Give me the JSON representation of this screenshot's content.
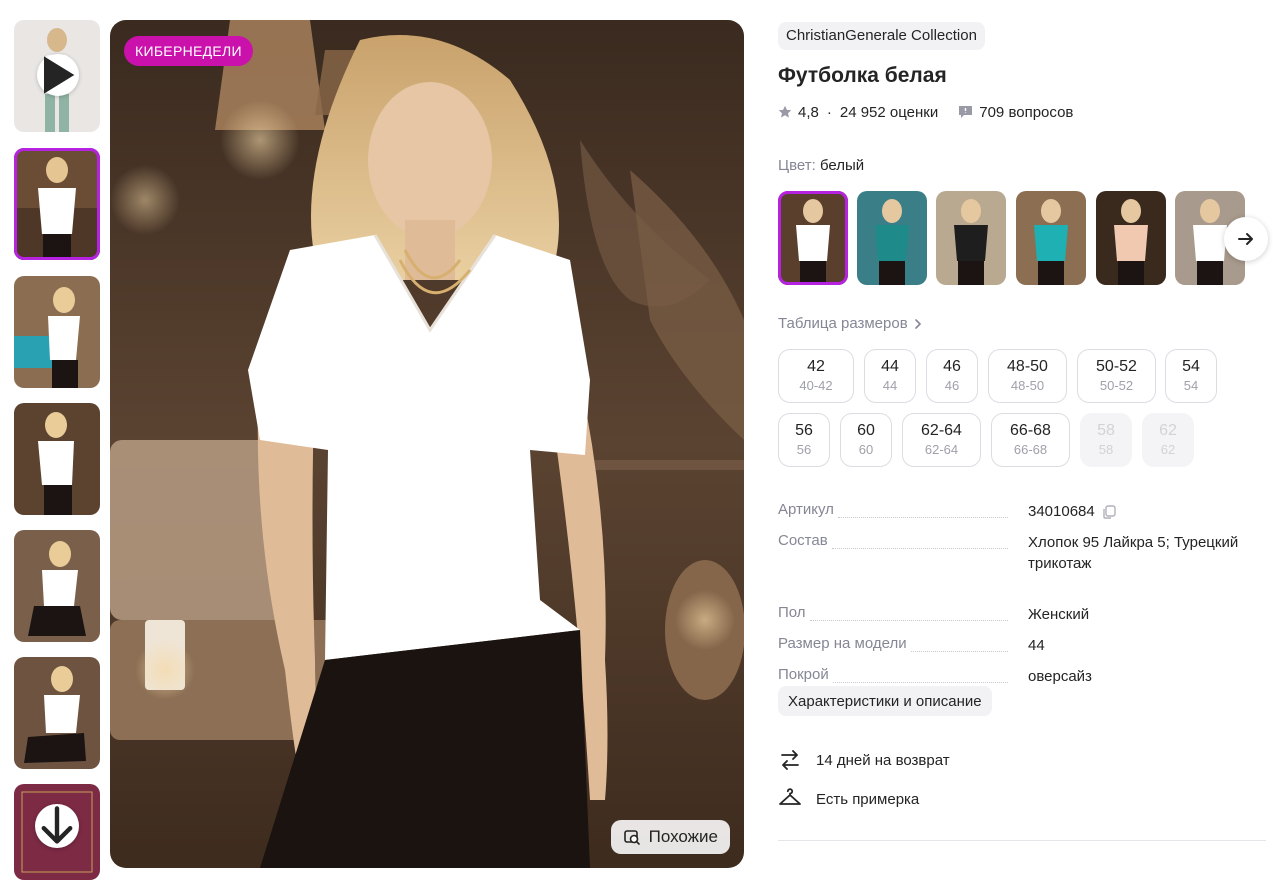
{
  "gallery": {
    "thumbnails": [
      {
        "kind": "video",
        "icon": "play-icon"
      },
      {
        "kind": "photo",
        "shirt": "#ffffff",
        "selected": true
      },
      {
        "kind": "photo",
        "shirt": "#ffffff"
      },
      {
        "kind": "photo",
        "shirt": "#ffffff"
      },
      {
        "kind": "photo",
        "shirt": "#ffffff"
      },
      {
        "kind": "photo",
        "shirt": "#ffffff"
      },
      {
        "kind": "certificate",
        "icon": "arrow-down-icon"
      }
    ],
    "promo_badge": "КИБЕРНЕДЕЛИ",
    "similar_label": "Похожие"
  },
  "product": {
    "brand": "ChristianGenerale Collection",
    "title": "Футболка белая",
    "rating": "4,8",
    "reviews": "24 952 оценки",
    "questions": "709 вопросов",
    "color_label": "Цвет:",
    "color_value": "белый",
    "color_variants": [
      {
        "shirt": "#ffffff",
        "bg": "#5a3f2c",
        "selected": true
      },
      {
        "shirt": "#1f8a8a",
        "bg": "#3a7f88"
      },
      {
        "shirt": "#1e1e1e",
        "bg": "#b9a990"
      },
      {
        "shirt": "#1fb0b3",
        "bg": "#8c6f52"
      },
      {
        "shirt": "#f0c9b0",
        "bg": "#3a2a1e"
      },
      {
        "shirt": "#ffffff",
        "bg": "#a89a8c"
      }
    ],
    "size_chart_label": "Таблица размеров",
    "sizes": [
      {
        "size": "42",
        "ru": "40-42",
        "available": true
      },
      {
        "size": "44",
        "ru": "44",
        "available": true
      },
      {
        "size": "46",
        "ru": "46",
        "available": true
      },
      {
        "size": "48-50",
        "ru": "48-50",
        "available": true
      },
      {
        "size": "50-52",
        "ru": "50-52",
        "available": true
      },
      {
        "size": "54",
        "ru": "54",
        "available": true
      },
      {
        "size": "56",
        "ru": "56",
        "available": true
      },
      {
        "size": "60",
        "ru": "60",
        "available": true
      },
      {
        "size": "62-64",
        "ru": "62-64",
        "available": true
      },
      {
        "size": "66-68",
        "ru": "66-68",
        "available": true
      },
      {
        "size": "58",
        "ru": "58",
        "available": false
      },
      {
        "size": "62",
        "ru": "62",
        "available": false
      }
    ],
    "specs": [
      {
        "key": "Артикул",
        "value": "34010684"
      },
      {
        "key": "Состав",
        "value": "Хлопок 95 Лайкра 5; Турецкий трикотаж"
      },
      {
        "key": "Пол",
        "value": "Женский"
      },
      {
        "key": "Размер на модели",
        "value": "44"
      },
      {
        "key": "Покрой",
        "value": "оверсайз"
      }
    ],
    "description_button": "Характеристики и описание",
    "perks": [
      {
        "icon": "return-arrows-icon",
        "label": "14 дней на возврат"
      },
      {
        "icon": "hanger-icon",
        "label": "Есть примерка"
      }
    ]
  },
  "colors": {
    "accent": "#cb11ab",
    "selection": "#b522e0",
    "muted_text": "#868695",
    "text": "#242424"
  }
}
